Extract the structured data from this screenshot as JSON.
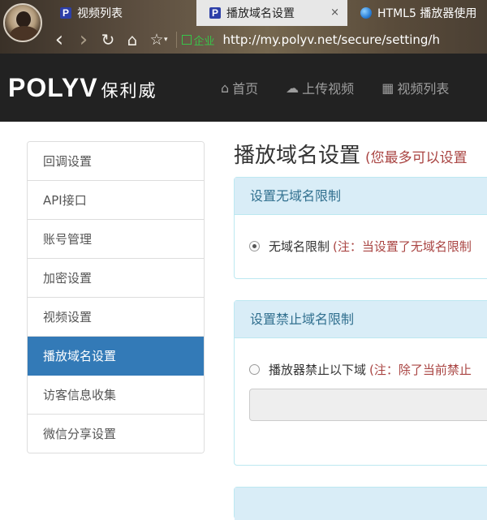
{
  "browser": {
    "tabs": [
      {
        "label": "视频列表",
        "icon": "polyv-favicon",
        "active": false
      },
      {
        "label": "播放域名设置",
        "icon": "polyv-favicon",
        "active": true,
        "close": "×"
      },
      {
        "label": "HTML5 播放器使用",
        "icon": "globe-favicon",
        "active": false
      }
    ],
    "toolbar": {
      "back": "‹",
      "forward": "›",
      "reload": "↻",
      "home": "⌂",
      "favorite": "☆",
      "favorite_dropdown": "▾"
    },
    "address": {
      "badge": "企业",
      "url": "http://my.polyv.net/secure/setting/h"
    }
  },
  "site": {
    "brand_latin": "POLYV",
    "brand_cn": "保利威",
    "nav": [
      {
        "label": "首页",
        "icon": "home-icon",
        "glyph": "⌂"
      },
      {
        "label": "上传视频",
        "icon": "cloud-upload-icon",
        "glyph": "☁"
      },
      {
        "label": "视频列表",
        "icon": "film-icon",
        "glyph": "▦"
      }
    ]
  },
  "sidebar": {
    "items": [
      {
        "label": "回调设置",
        "active": false
      },
      {
        "label": "API接口",
        "active": false
      },
      {
        "label": "账号管理",
        "active": false
      },
      {
        "label": "加密设置",
        "active": false
      },
      {
        "label": "视频设置",
        "active": false
      },
      {
        "label": "播放域名设置",
        "active": true
      },
      {
        "label": "访客信息收集",
        "active": false
      },
      {
        "label": "微信分享设置",
        "active": false
      }
    ]
  },
  "main": {
    "title": "播放域名设置",
    "subtitle": "(您最多可以设置",
    "panels": [
      {
        "heading": "设置无域名限制",
        "option_label": "无域名限制",
        "note": "(注：当设置了无域名限制",
        "checked": true
      },
      {
        "heading": "设置禁止域名限制",
        "option_label": "播放器禁止以下域",
        "note": "(注：除了当前禁止",
        "checked": false,
        "input_value": ""
      }
    ]
  },
  "colors": {
    "active_blue": "#337ab7",
    "panel_head_bg": "#d9edf7",
    "panel_border": "#bce8f1",
    "panel_head_text": "#31708f",
    "note_red": "#a94442",
    "header_bg": "#222222"
  }
}
